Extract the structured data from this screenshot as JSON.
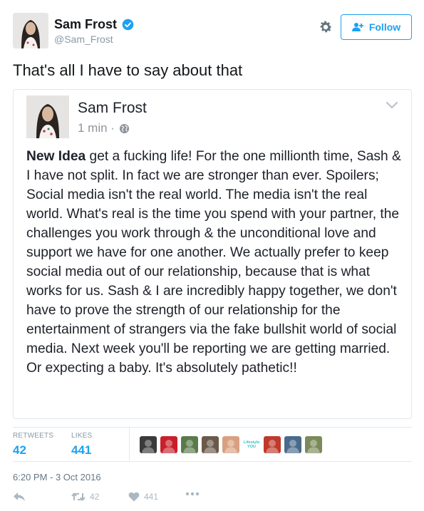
{
  "tweet": {
    "author": {
      "display_name": "Sam Frost",
      "handle": "@Sam_Frost",
      "verified": true
    },
    "follow_label": "Follow",
    "text": "That's all I have to say about that",
    "embedded_post": {
      "author": "Sam Frost",
      "time": "1 min ·",
      "body_bold": "New Idea",
      "body_rest": " get a fucking life! For the one millionth time, Sash & I have not split. In fact we are stronger than ever. Spoilers; Social media isn't the real world. The media isn't the real world. What's real is the time you spend with your partner, the challenges you work through & the unconditional love and support we have for one another. We actually prefer to keep social media out of our relationship, because that is what works for us. Sash & I are incredibly happy together, we don't have to prove the strength of our relationship for the entertainment of strangers via the fake bullshit world of social media. Next week you'll be reporting we are getting married. Or expecting a baby. It's absolutely pathetic!!"
    },
    "stats": {
      "retweets_label": "RETWEETS",
      "retweets_value": "42",
      "likes_label": "LIKES",
      "likes_value": "441"
    },
    "likers": [
      {
        "label": "",
        "color": "#3a3a3a"
      },
      {
        "label": "",
        "color": "#c8202a"
      },
      {
        "label": "",
        "color": "#5a7a4a"
      },
      {
        "label": "",
        "color": "#6b5a4a"
      },
      {
        "label": "",
        "color": "#d9a080"
      },
      {
        "label": "Lifestyle YOU",
        "color": "#2ec5c0"
      },
      {
        "label": "",
        "color": "#c0392b"
      },
      {
        "label": "",
        "color": "#4a6a8a"
      },
      {
        "label": "",
        "color": "#7a8a5a"
      }
    ],
    "timestamp": "6:20 PM - 3 Oct 2016",
    "actions": {
      "retweet_count": "42",
      "like_count": "441"
    },
    "colors": {
      "accent": "#1da1f2",
      "muted": "#8899a6"
    }
  }
}
